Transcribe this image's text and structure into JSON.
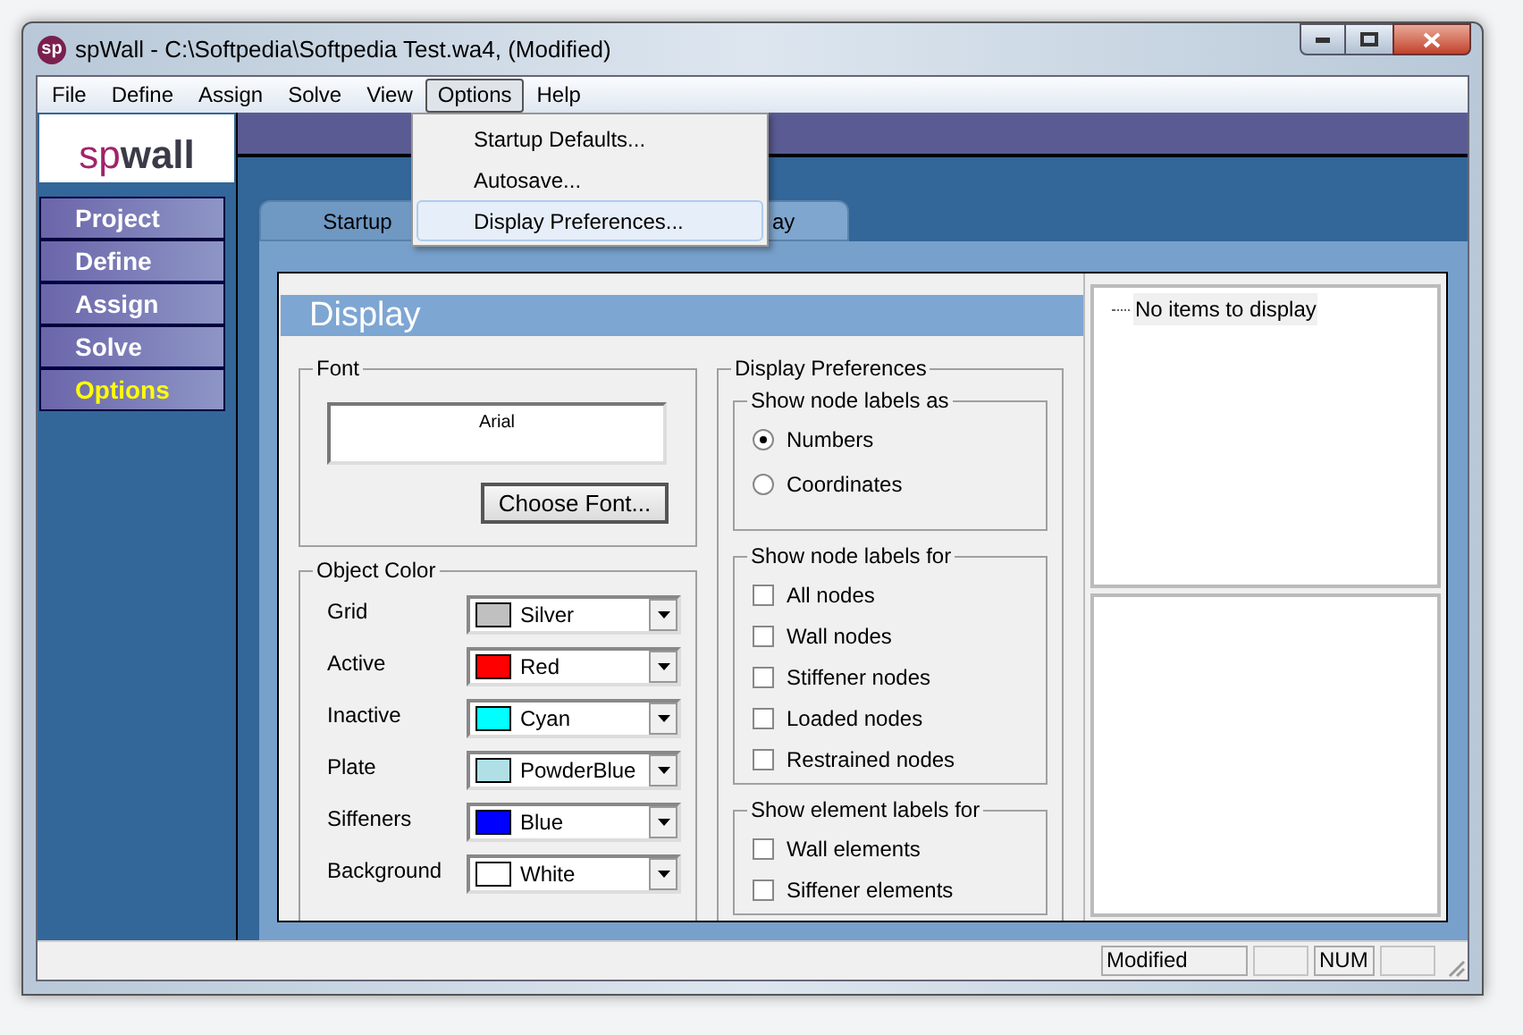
{
  "window": {
    "title": "spWall - C:\\Softpedia\\Softpedia Test.wa4, (Modified)",
    "icon_text": "sp"
  },
  "menu_bar": [
    {
      "label": "File",
      "selected": false
    },
    {
      "label": "Define",
      "selected": false
    },
    {
      "label": "Assign",
      "selected": false
    },
    {
      "label": "Solve",
      "selected": false
    },
    {
      "label": "View",
      "selected": false
    },
    {
      "label": "Options",
      "selected": true
    },
    {
      "label": "Help",
      "selected": false
    }
  ],
  "dropdown_menu": [
    {
      "label": "Startup Defaults...",
      "selected": false
    },
    {
      "label": "Autosave...",
      "selected": false
    },
    {
      "label": "Display Preferences...",
      "selected": true
    }
  ],
  "logo": {
    "prefix": "sp",
    "name": "wall"
  },
  "sidebar": {
    "items": [
      {
        "label": "Project",
        "selected": false
      },
      {
        "label": "Define",
        "selected": false
      },
      {
        "label": "Assign",
        "selected": false
      },
      {
        "label": "Solve",
        "selected": false
      },
      {
        "label": "Options",
        "selected": true
      }
    ]
  },
  "tabs": [
    {
      "label": "Startup",
      "selected": false
    },
    {
      "label": "ay",
      "selected": true
    }
  ],
  "panel_title": "Display",
  "font_group": {
    "title": "Font",
    "preview": "Arial",
    "button": "Choose Font..."
  },
  "object_color": {
    "title": "Object Color",
    "rows": [
      {
        "label": "Grid",
        "value": "Silver",
        "color": "#c0c0c0"
      },
      {
        "label": "Active",
        "value": "Red",
        "color": "#ff0000"
      },
      {
        "label": "Inactive",
        "value": "Cyan",
        "color": "#00ffff"
      },
      {
        "label": "Plate",
        "value": "PowderBlue",
        "color": "#b0e0e6"
      },
      {
        "label": "Siffeners",
        "value": "Blue",
        "color": "#0000ff"
      },
      {
        "label": "Background",
        "value": "White",
        "color": "#ffffff"
      }
    ]
  },
  "display_preferences": {
    "title": "Display Preferences",
    "groups": [
      {
        "title": "Show node labels as",
        "kind": "radio",
        "options": [
          {
            "label": "Numbers",
            "selected": true
          },
          {
            "label": "Coordinates",
            "selected": false
          }
        ]
      },
      {
        "title": "Show node labels for",
        "kind": "checkbox",
        "options": [
          {
            "label": "All nodes",
            "checked": false
          },
          {
            "label": "Wall nodes",
            "checked": false
          },
          {
            "label": "Stiffener nodes",
            "checked": false
          },
          {
            "label": "Loaded nodes",
            "checked": false
          },
          {
            "label": "Restrained nodes",
            "checked": false
          }
        ]
      },
      {
        "title": "Show element labels for",
        "kind": "checkbox",
        "options": [
          {
            "label": "Wall elements",
            "checked": false
          },
          {
            "label": "Siffener elements",
            "checked": false
          }
        ]
      }
    ]
  },
  "tree": {
    "items": [
      "No items to display"
    ]
  },
  "status_bar": [
    {
      "text": "Modified"
    },
    {
      "kind": "blank"
    },
    {
      "text": "NUM"
    },
    {
      "kind": "blank"
    }
  ]
}
